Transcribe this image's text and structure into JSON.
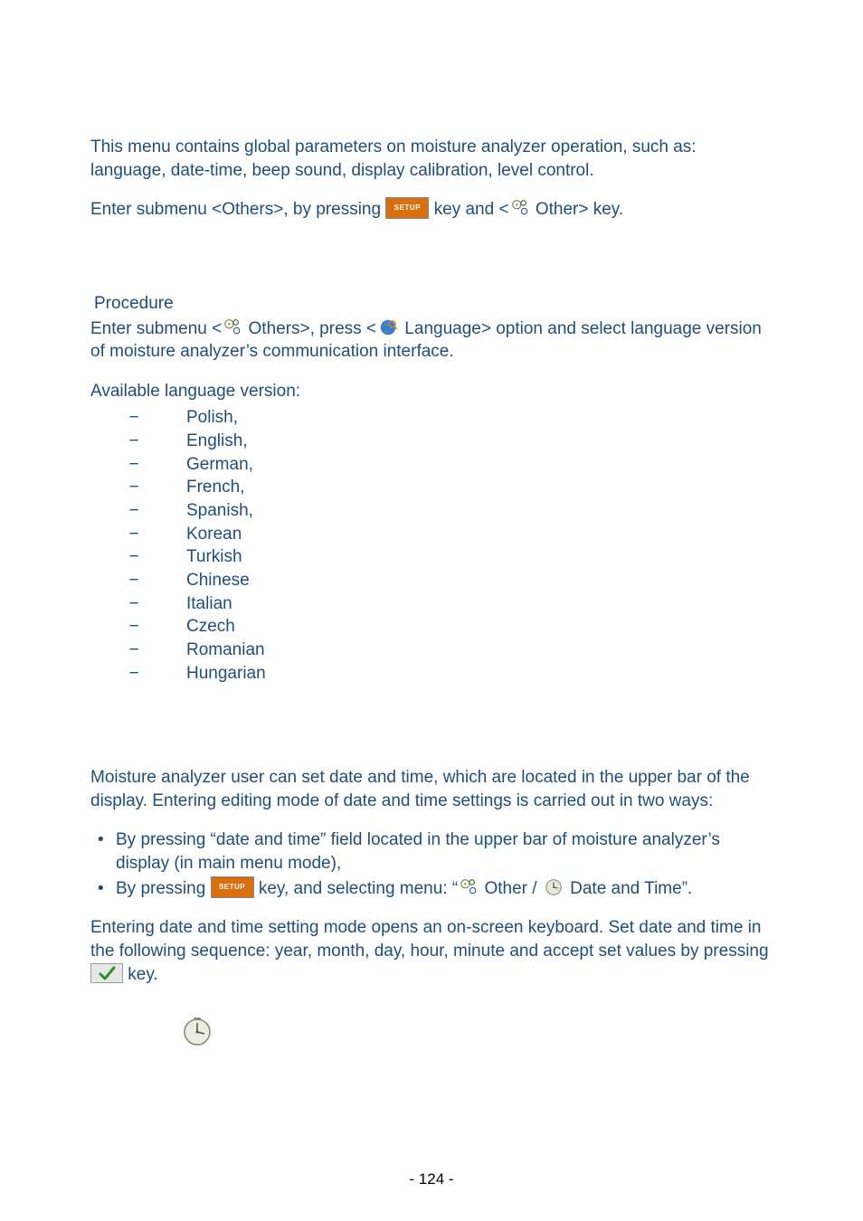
{
  "intro": "This menu contains global parameters on moisture analyzer operation, such as: language, date-time, beep sound, display calibration, level control.",
  "enter_submenu": {
    "pre": "Enter submenu <Others>, by pressing ",
    "mid": " key and <",
    "post": " Other> key."
  },
  "procedure_label": "Procedure",
  "procedure": {
    "pre": "Enter submenu <",
    "mid1": " Others>, press <",
    "mid2": " Language> option and select language version of moisture analyzer’s communication interface."
  },
  "available_label": "Available language version:",
  "languages": [
    "Polish,",
    "English,",
    "German,",
    "French,",
    "Spanish,",
    "Korean",
    "Turkish",
    "Chinese",
    "Italian",
    "Czech",
    "Romanian",
    "Hungarian"
  ],
  "datetime_intro": "Moisture analyzer user can set date and time, which are located in the upper bar of the display. Entering editing mode of date and time settings is carried out in two ways:",
  "dt_bullet1": "By pressing “date and time” field located in the upper bar of moisture analyzer’s display (in main menu mode),",
  "dt_bullet2": {
    "pre": "By pressing ",
    "mid": " key, and selecting menu: “",
    "mid2": " Other / ",
    "post": " Date and Time”."
  },
  "dt_outro": {
    "pre": "Entering date and time setting mode opens an on-screen keyboard. Set date and time in the following sequence: year, month, day, hour, minute and accept set values by pressing ",
    "post": " key."
  },
  "setup_label": "SETUP",
  "page_number": "- 124 -"
}
